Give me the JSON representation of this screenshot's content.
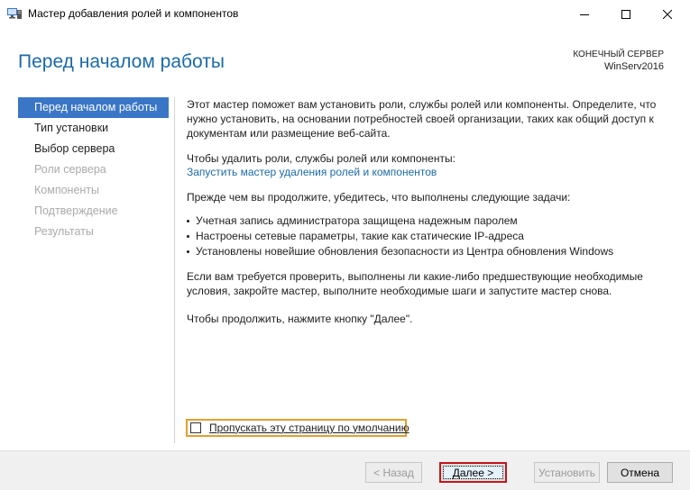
{
  "window": {
    "title": "Мастер добавления ролей и компонентов",
    "icon": "server-manager-icon"
  },
  "header": {
    "page_title": "Перед началом работы",
    "server_label": "КОНЕЧНЫЙ СЕРВЕР",
    "server_name": "WinServ2016"
  },
  "nav": {
    "items": [
      {
        "label": "Перед началом работы",
        "state": "active"
      },
      {
        "label": "Тип установки",
        "state": "enabled"
      },
      {
        "label": "Выбор сервера",
        "state": "enabled"
      },
      {
        "label": "Роли сервера",
        "state": "disabled"
      },
      {
        "label": "Компоненты",
        "state": "disabled"
      },
      {
        "label": "Подтверждение",
        "state": "disabled"
      },
      {
        "label": "Результаты",
        "state": "disabled"
      }
    ]
  },
  "content": {
    "intro": "Этот мастер поможет вам установить роли, службы ролей или компоненты. Определите, что нужно установить, на основании потребностей своей организации, таких как общий доступ к документам или размещение веб-сайта.",
    "remove_prompt": "Чтобы удалить роли, службы ролей или компоненты:",
    "remove_link": "Запустить мастер удаления ролей и компонентов",
    "tasks_prompt": "Прежде чем вы продолжите, убедитесь, что выполнены следующие задачи:",
    "tasks": [
      "Учетная запись администратора защищена надежным паролем",
      "Настроены сетевые параметры, такие как статические IP-адреса",
      "Установлены новейшие обновления безопасности из Центра обновления Windows"
    ],
    "verify_note": "Если вам требуется проверить, выполнены ли какие-либо предшествующие необходимые условия, закройте мастер, выполните необходимые шаги и запустите мастер снова.",
    "continue_note": "Чтобы продолжить, нажмите кнопку \"Далее\"."
  },
  "skip_checkbox": {
    "label": "Пропускать эту страницу по умолчанию",
    "checked": false
  },
  "buttons": {
    "back": "< Назад",
    "next": "Далее >",
    "install": "Установить",
    "cancel": "Отмена"
  },
  "colors": {
    "accent": "#1b6aa8",
    "nav_active_bg": "#3a76c6",
    "highlight_checkbox": "#e0a030",
    "highlight_next": "#c2161c"
  }
}
